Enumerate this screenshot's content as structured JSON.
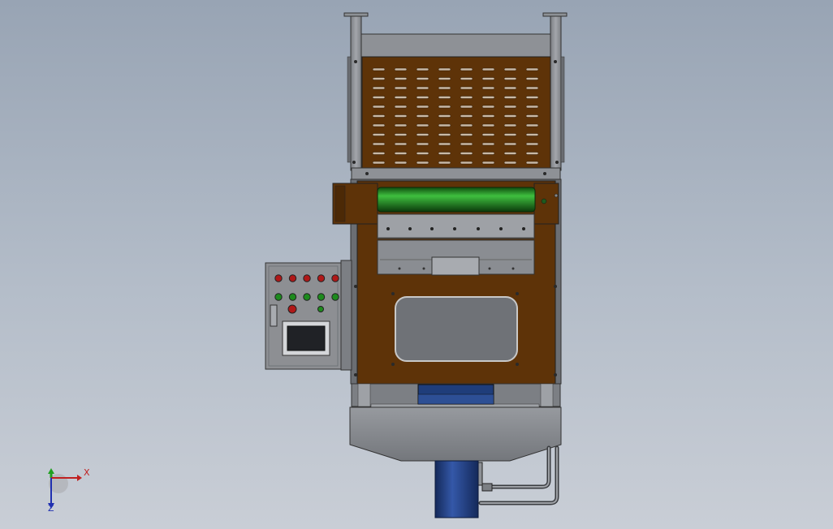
{
  "viewport": {
    "background_top": "#98a4b4",
    "background_bottom": "#c9ced6"
  },
  "colors": {
    "frame_steel": "#8e9196",
    "frame_dark": "#5b5e63",
    "body_brown": "#5e3308",
    "roller_green": "#1e7a1e",
    "cylinder_blue": "#1f3d7a",
    "panel_grey": "#8d8f93",
    "button_red": "#b01818",
    "button_green": "#1d8a1d"
  },
  "control_panel": {
    "button_rows": [
      [
        "red",
        "red",
        "red",
        "red",
        "red"
      ],
      [
        "green",
        "green",
        "green",
        "green",
        "green"
      ]
    ],
    "extra_buttons": [
      "red",
      "green"
    ],
    "screen": "hmi-screen"
  },
  "triad": {
    "x_label": "X",
    "z_label": "Z",
    "y_color": "#1fa01f",
    "x_color": "#c02020",
    "z_color": "#2030b0"
  }
}
